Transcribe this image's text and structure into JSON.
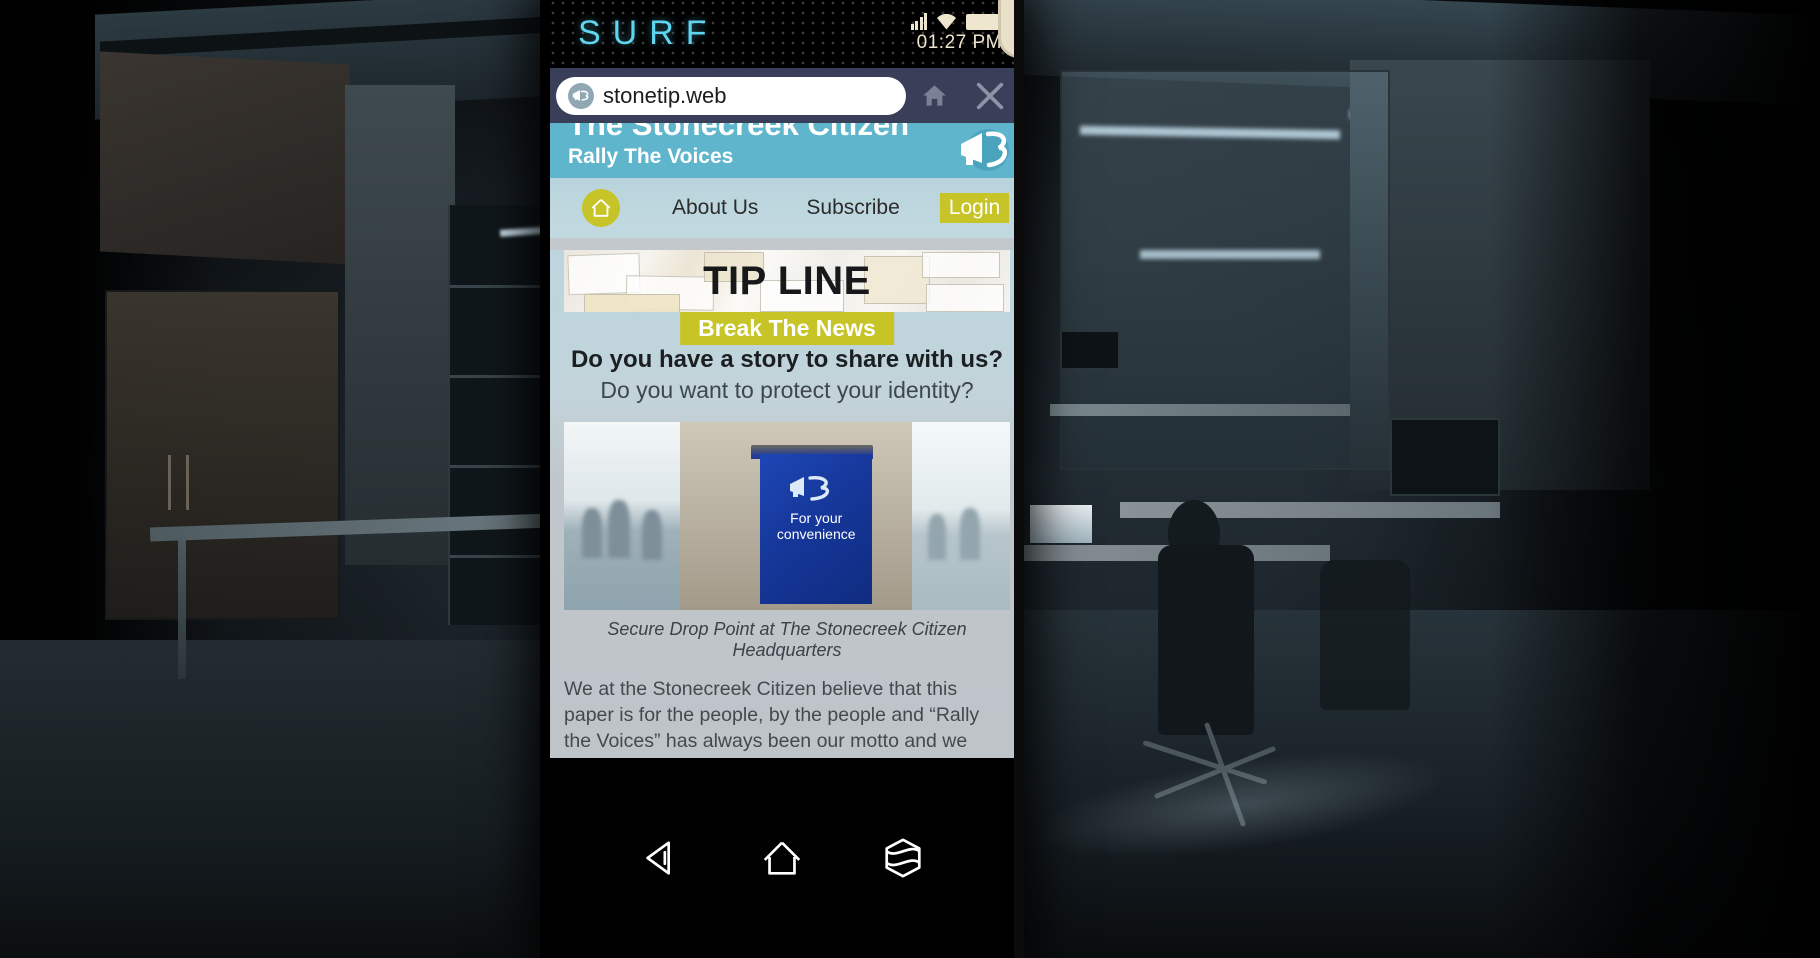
{
  "status_bar": {
    "app_name": "SURF",
    "clock": "01:27 PM",
    "icons": [
      "signal-icon",
      "wifi-icon",
      "battery-icon"
    ]
  },
  "browser": {
    "url": "stonetip.web",
    "favicon": "megaphone-favicon",
    "home_button": "home-icon",
    "close_button": "close-icon"
  },
  "site": {
    "title": "The Stonecreek Citizen",
    "tagline": "Rally The Voices",
    "logo": "megaphone-logo",
    "nav": {
      "home_icon": "house-icon",
      "about": "About Us",
      "subscribe": "Subscribe",
      "login": "Login"
    },
    "banner": {
      "title": "TIP LINE",
      "subtitle": "Break The News"
    },
    "questions": {
      "primary": "Do you have a story to share with us?",
      "secondary": "Do you want to protect your identity?"
    },
    "figure": {
      "dropbox_text_line1": "For your",
      "dropbox_text_line2": "convenience",
      "dropbox_logo": "megaphone-logo",
      "caption": "Secure Drop Point at The Stonecreek Citizen Headquarters"
    },
    "body_copy": "We at the Stonecreek Citizen believe that this paper is for the people, by the people and “Rally the Voices” has always been our motto and we strive to reflect that. If there is something that you wish to say that needs our attention, please submit an anonymous tip to us through our secure drop points."
  },
  "cursor": {
    "type": "magnifier-cursor"
  },
  "android_nav": {
    "back": "back-triangle-icon",
    "home": "home-outline-icon",
    "recents": "recents-hexagon-icon"
  },
  "colors": {
    "surf_cyan": "#5fd6f0",
    "chrome_navy": "#3a3f59",
    "masthead_teal": "#5fb6cc",
    "accent_olive": "#c6c426",
    "dropbox_blue": "#16379a",
    "status_cream": "#efe6d0"
  }
}
